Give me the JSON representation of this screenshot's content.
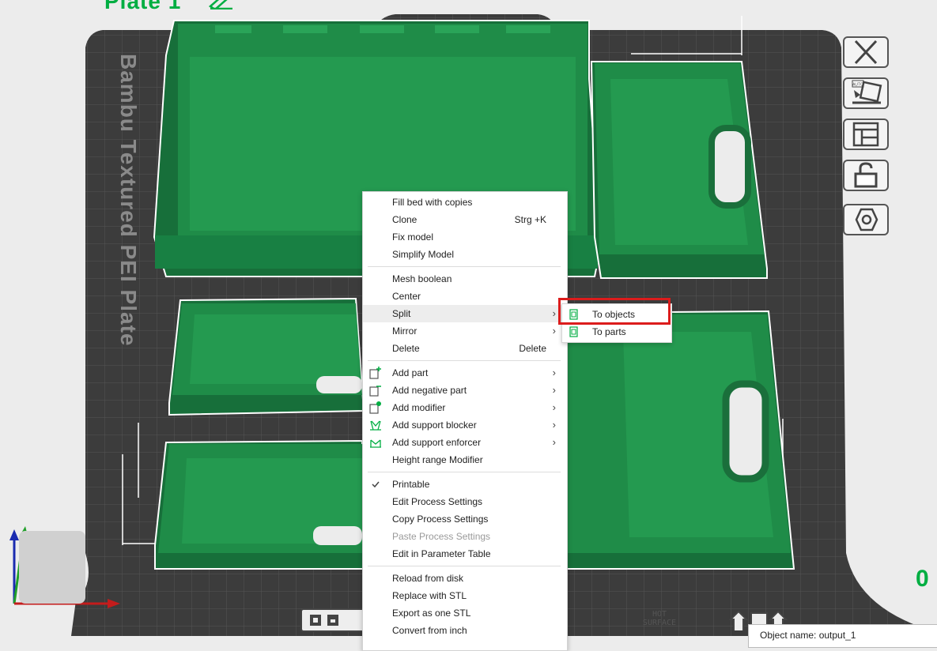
{
  "plate": {
    "title": "Plate 1"
  },
  "bed": {
    "label": "Bambu Textured PEI Plate",
    "hot_surface": "HOT\nSURFACE"
  },
  "toolbar_right": [
    {
      "name": "close-icon"
    },
    {
      "name": "auto-arrange-icon",
      "badge": "AUTO"
    },
    {
      "name": "layout-icon"
    },
    {
      "name": "lock-icon"
    },
    {
      "name": "hexagon-icon"
    }
  ],
  "side_value": "0",
  "object_name": "Object name: output_1",
  "colors": {
    "model": "#1e8c4a",
    "accent": "#00ae42",
    "highlight": "#dc1c1c",
    "bed": "#3c3c3c"
  },
  "context_menu": {
    "items": [
      {
        "label": "Fill bed with copies"
      },
      {
        "label": "Clone",
        "shortcut": "Strg +K"
      },
      {
        "label": "Fix model"
      },
      {
        "label": "Simplify Model"
      },
      {
        "separator": true
      },
      {
        "label": "Mesh boolean"
      },
      {
        "label": "Center"
      },
      {
        "label": "Split",
        "submenu": true,
        "highlighted": true
      },
      {
        "label": "Mirror",
        "submenu": true
      },
      {
        "label": "Delete",
        "shortcut": "Delete"
      },
      {
        "separator": true
      },
      {
        "label": "Add part",
        "submenu": true,
        "icon": "add-part-icon"
      },
      {
        "label": "Add negative part",
        "submenu": true,
        "icon": "add-negative-part-icon"
      },
      {
        "label": "Add modifier",
        "submenu": true,
        "icon": "add-modifier-icon"
      },
      {
        "label": "Add support blocker",
        "submenu": true,
        "icon": "support-blocker-icon"
      },
      {
        "label": "Add support enforcer",
        "submenu": true,
        "icon": "support-enforcer-icon"
      },
      {
        "label": "Height range Modifier"
      },
      {
        "separator": true
      },
      {
        "label": "Printable",
        "checked": true
      },
      {
        "label": "Edit Process Settings"
      },
      {
        "label": "Copy Process Settings"
      },
      {
        "label": "Paste Process Settings",
        "disabled": true
      },
      {
        "label": "Edit in Parameter Table"
      },
      {
        "separator": true
      },
      {
        "label": "Reload from disk"
      },
      {
        "label": "Replace with STL"
      },
      {
        "label": "Export as one STL"
      },
      {
        "label": "Convert from inch"
      }
    ]
  },
  "split_submenu": {
    "items": [
      {
        "label": "To objects",
        "icon": "split-objects-icon"
      },
      {
        "label": "To parts",
        "icon": "split-parts-icon"
      }
    ]
  }
}
